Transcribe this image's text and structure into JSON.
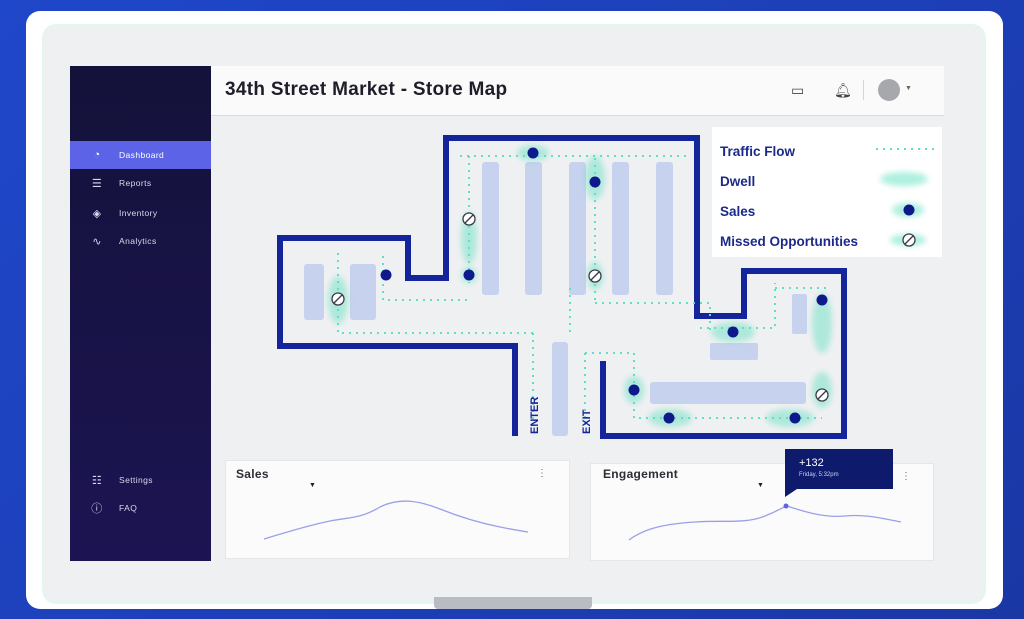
{
  "page": {
    "title": "34th Street Market - Store Map"
  },
  "sidebar": {
    "items": [
      {
        "label": "Dashboard",
        "icon": "gauge-icon"
      },
      {
        "label": "Reports",
        "icon": "list-icon"
      },
      {
        "label": "Inventory",
        "icon": "layers-icon"
      },
      {
        "label": "Analytics",
        "icon": "pulse-icon"
      }
    ],
    "bottom_items": [
      {
        "label": "Settings",
        "icon": "sliders-icon"
      },
      {
        "label": "FAQ",
        "icon": "info-icon"
      }
    ]
  },
  "header": {
    "icons": [
      "calendar-icon",
      "bell-icon",
      "avatar"
    ]
  },
  "map": {
    "enter_label": "ENTER",
    "exit_label": "EXIT"
  },
  "legend": {
    "items": [
      {
        "label": "Traffic Flow"
      },
      {
        "label": "Dwell"
      },
      {
        "label": "Sales"
      },
      {
        "label": "Missed Opportunities"
      }
    ]
  },
  "cards": {
    "sales": {
      "title": "Sales"
    },
    "engagement": {
      "title": "Engagement"
    }
  },
  "tooltip": {
    "value": "+132",
    "subtitle": "Friday, 5:32pm"
  },
  "colors": {
    "accent": "#5c63e6",
    "wall": "#14249a",
    "shelf": "#c6d2ee",
    "flow": "#5fe0c0",
    "sale_dot": "#0e1a8c"
  }
}
